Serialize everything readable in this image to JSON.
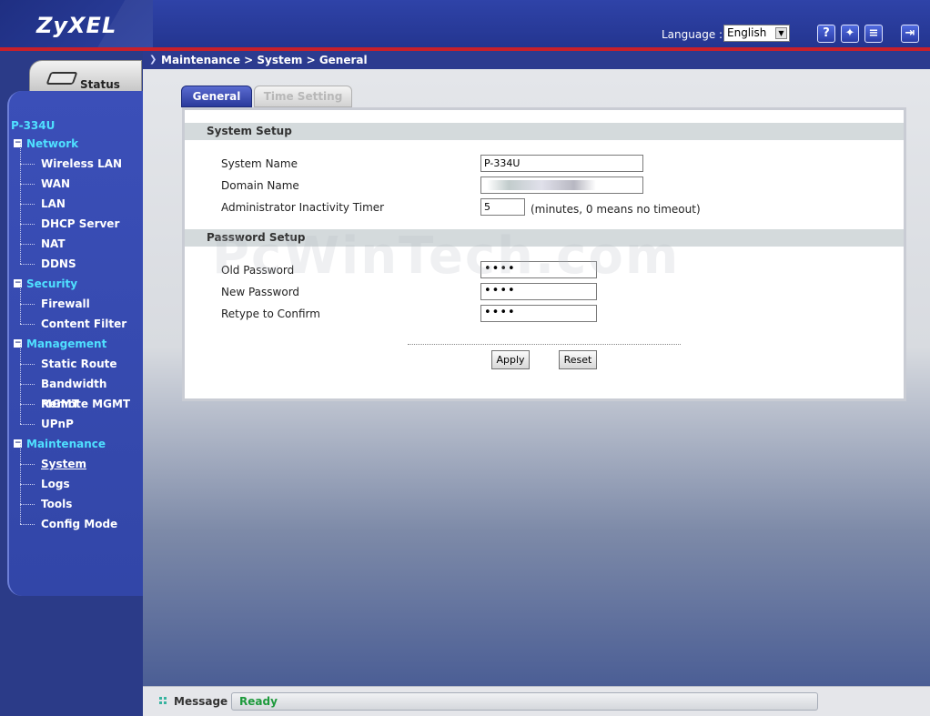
{
  "header": {
    "logo": "ZyXEL",
    "language_label": "Language :",
    "language_value": "English",
    "icons": [
      "help-icon",
      "wizard-icon",
      "notes-icon",
      "logout-icon"
    ]
  },
  "sidebar": {
    "status_label": "Status",
    "device": "P-334U",
    "groups": [
      {
        "label": "Network",
        "items": [
          "Wireless LAN",
          "WAN",
          "LAN",
          "DHCP Server",
          "NAT",
          "DDNS"
        ]
      },
      {
        "label": "Security",
        "items": [
          "Firewall",
          "Content Filter"
        ]
      },
      {
        "label": "Management",
        "items": [
          "Static Route",
          "Bandwidth MGMT",
          "Remote MGMT",
          "UPnP"
        ]
      },
      {
        "label": "Maintenance",
        "items": [
          "System",
          "Logs",
          "Tools",
          "Config Mode"
        ]
      }
    ],
    "active_item": "System"
  },
  "breadcrumb": "Maintenance > System > General",
  "tabs": {
    "general": "General",
    "time_setting": "Time Setting"
  },
  "form": {
    "system_setup_title": "System Setup",
    "system_name_label": "System Name",
    "system_name_value": "P-334U",
    "domain_name_label": "Domain Name",
    "domain_name_value": "",
    "timer_label": "Administrator Inactivity Timer",
    "timer_value": "5",
    "timer_note": "(minutes, 0 means no timeout)",
    "password_setup_title": "Password Setup",
    "old_password_label": "Old Password",
    "old_password_value": "••••",
    "new_password_label": "New Password",
    "new_password_value": "••••",
    "retype_label": "Retype to Confirm",
    "retype_value": "••••",
    "apply_label": "Apply",
    "reset_label": "Reset"
  },
  "watermark": "PcWinTech.com",
  "message": {
    "label": "Message",
    "text": "Ready",
    "text_color": "#1e9a3c"
  },
  "colors": {
    "header_bg": "#2f43a8",
    "header_stripe": "#c8202a",
    "nav_group": "#4fe0ff",
    "nav_item": "#ffffff"
  }
}
